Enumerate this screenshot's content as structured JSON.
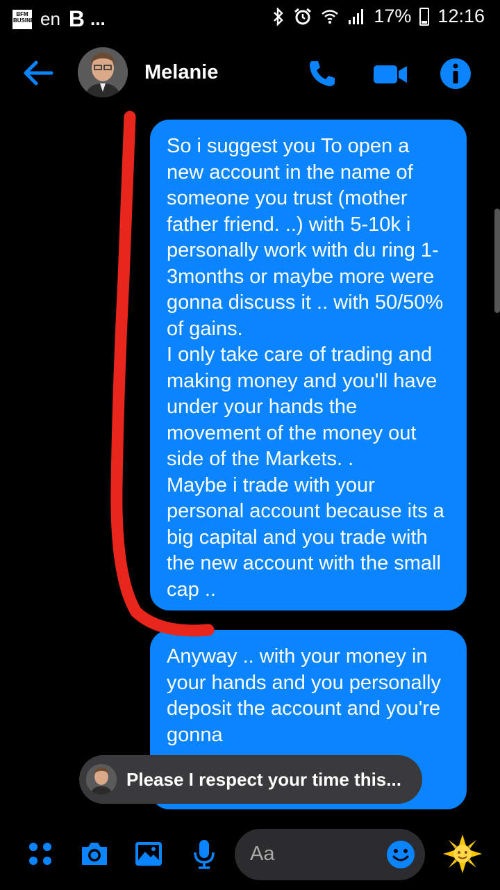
{
  "status_bar": {
    "app_badge_text": "BFM BUSINESS",
    "lang": "en",
    "letter": "B",
    "more": "...",
    "battery": "17%",
    "time": "12:16"
  },
  "header": {
    "contact_name": "Melanie"
  },
  "messages": [
    {
      "sender": "self",
      "text": "So i suggest you To open a new account in the name of someone you trust (mother father friend. ..) with 5-10k i personally work with du ring 1-3months or maybe more were gonna discuss it .. with 50/50% of gains.\nI only take care of trading and making money and you'll have under your hands the movement of the money out side of the Markets. .\nMaybe i trade with your personal account because its a big capital and you trade with the new account with the small cap .."
    },
    {
      "sender": "self",
      "text": "Anyway .. with your money in your hands and you personally deposit the account and you're gonna"
    }
  ],
  "reply_preview": {
    "text": "Please I respect your time this..."
  },
  "composer": {
    "placeholder": "Aa"
  },
  "colors": {
    "accent": "#0a84ff",
    "annotation": "#e8261c",
    "background": "#000000"
  },
  "icons": [
    "back-arrow-icon",
    "phone-icon",
    "video-camera-icon",
    "info-icon",
    "grid-menu-icon",
    "camera-icon",
    "image-icon",
    "microphone-icon",
    "emoji-icon",
    "sun-sticker-icon"
  ]
}
